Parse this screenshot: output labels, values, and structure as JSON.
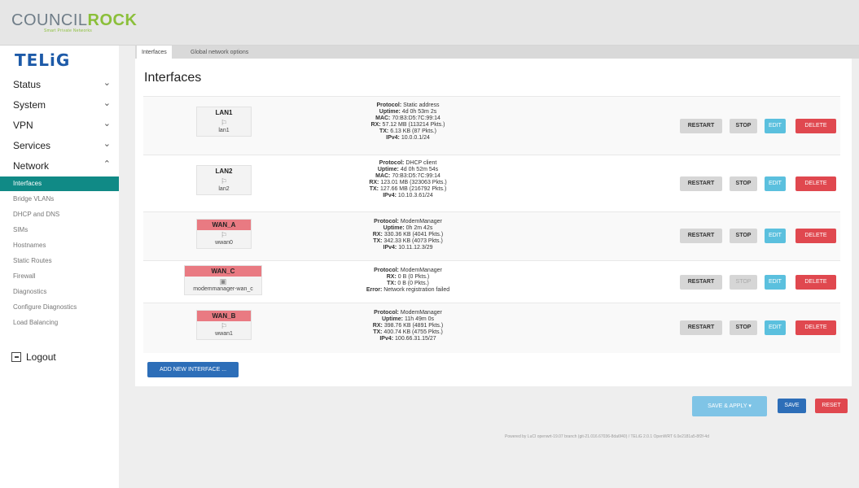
{
  "brand": {
    "name_part1": "COUNCIL",
    "name_part2": "ROCK",
    "tagline": "Smart Private Networks",
    "product": "TELiG"
  },
  "sidebar": {
    "menu": [
      {
        "label": "Status",
        "chevron": "⌄"
      },
      {
        "label": "System",
        "chevron": "⌄"
      },
      {
        "label": "VPN",
        "chevron": "⌄"
      },
      {
        "label": "Services",
        "chevron": "⌄"
      },
      {
        "label": "Network",
        "chevron": "⌃"
      }
    ],
    "submenu": [
      {
        "label": "Interfaces",
        "active": true
      },
      {
        "label": "Bridge VLANs"
      },
      {
        "label": "DHCP and DNS"
      },
      {
        "label": "SIMs"
      },
      {
        "label": "Hostnames"
      },
      {
        "label": "Static Routes"
      },
      {
        "label": "Firewall"
      },
      {
        "label": "Diagnostics"
      },
      {
        "label": "Configure Diagnostics"
      },
      {
        "label": "Load Balancing"
      }
    ],
    "logout": "Logout"
  },
  "tabs": [
    {
      "label": "Interfaces",
      "active": true
    },
    {
      "label": "Global network options"
    }
  ],
  "page_title": "Interfaces",
  "labels": {
    "protocol": "Protocol:",
    "uptime": "Uptime:",
    "mac": "MAC:",
    "rx": "RX:",
    "tx": "TX:",
    "ipv4": "IPv4:",
    "error": "Error:"
  },
  "interfaces": [
    {
      "name": "LAN1",
      "device_icon": "⚐",
      "device": "lan1",
      "protocol": "Static address",
      "uptime": "4d 0h 53m 2s",
      "mac": "70:B3:D5:7C:99:14",
      "rx": "57.12 MB (113214 Pkts.)",
      "tx": "6.13 KB (87 Pkts.)",
      "ipv4": "10.0.0.1/24"
    },
    {
      "name": "LAN2",
      "device_icon": "⚐",
      "device": "lan2",
      "protocol": "DHCP client",
      "uptime": "4d 0h 52m 54s",
      "mac": "70:B3:D5:7C:99:14",
      "rx": "123.01 MB (323063 Pkts.)",
      "tx": "127.66 MB (216792 Pkts.)",
      "ipv4": "10.10.3.61/24"
    },
    {
      "name": "WAN_A",
      "device_icon": "⚐",
      "device": "wwan0",
      "protocol": "ModemManager",
      "uptime": "0h 2m 42s",
      "rx": "330.36 KB (4041 Pkts.)",
      "tx": "342.33 KB (4073 Pkts.)",
      "ipv4": "10.11.12.3/29"
    },
    {
      "name": "WAN_C",
      "device_icon": "▣",
      "device": "modemmanager-wan_c",
      "protocol": "ModemManager",
      "rx": "0 B (0 Pkts.)",
      "tx": "0 B (0 Pkts.)",
      "error": "Network registration failed"
    },
    {
      "name": "WAN_B",
      "device_icon": "⚐",
      "device": "wwan1",
      "protocol": "ModemManager",
      "uptime": "11h 49m 0s",
      "rx": "398.76 KB (4891 Pkts.)",
      "tx": "400.74 KB (4755 Pkts.)",
      "ipv4": "100.66.31.15/27"
    }
  ],
  "buttons": {
    "restart": "RESTART",
    "stop": "STOP",
    "edit": "EDIT",
    "delete": "DELETE",
    "add": "ADD NEW INTERFACE ...",
    "save_apply": "SAVE & APPLY ▾",
    "save": "SAVE",
    "reset": "RESET"
  },
  "footer": "Powered by LuCI openwrt-19.07 branch (git-21.016.67036-8da6f40) / TELiG 2.0.1 OpenWRT 6.0e2181a5-8f2f-4d",
  "colors": {
    "accent": "#108a86",
    "brand_blue": "#1d5aa8",
    "brand_green": "#8bbf3a",
    "delete": "#e0484f",
    "edit": "#5bc0de",
    "primary": "#2d6eb8",
    "wan_label": "#e97a82"
  }
}
